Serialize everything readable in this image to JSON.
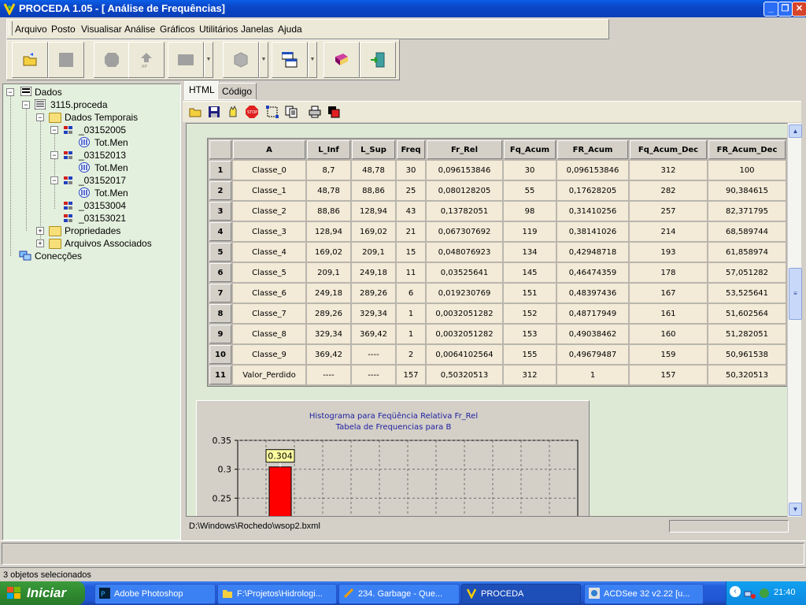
{
  "window": {
    "title": "PROCEDA 1.05 - [ Análise de Frequências]",
    "controls": [
      "minimize",
      "restore",
      "close"
    ]
  },
  "menu": [
    "Arquivo",
    "Posto",
    "Visualisar",
    "Análise",
    "Gráficos",
    "Utilitários",
    "Janelas",
    "Ajuda"
  ],
  "toolbar": {
    "icons": [
      "open-folder-icon",
      "stop-square-icon",
      "polygon-icon",
      "upload-area-icon",
      "rectangle-icon",
      "cube-icon",
      "windows-cascade-icon",
      "help-book-icon",
      "exit-door-icon"
    ]
  },
  "tree": {
    "root": "Dados",
    "file": "3115.proceda",
    "temporal": "Dados Temporais",
    "stations": [
      {
        "name": "_03152005",
        "child": "Tot.Men"
      },
      {
        "name": "_03152013",
        "child": "Tot.Men"
      },
      {
        "name": "_03152017",
        "child": "Tot.Men"
      },
      {
        "name": "_03153004",
        "child": ""
      },
      {
        "name": "_03153021",
        "child": ""
      }
    ],
    "props": "Propriedades",
    "assoc": "Arquivos Associados",
    "connections": "Conecções"
  },
  "tabs": [
    "HTML",
    "Código"
  ],
  "html_toolbar_icons": [
    "open-icon",
    "save-icon",
    "hand-icon",
    "stop-icon",
    "select-icon",
    "copy-icon",
    "print-icon",
    "color-icon"
  ],
  "table": {
    "headers": [
      "A",
      "L_Inf",
      "L_Sup",
      "Freq",
      "Fr_Rel",
      "Fq_Acum",
      "FR_Acum",
      "Fq_Acum_Dec",
      "FR_Acum_Dec"
    ],
    "rows": [
      [
        "1",
        "Classe_0",
        "8,7",
        "48,78",
        "30",
        "0,096153846",
        "30",
        "0,096153846",
        "312",
        "100"
      ],
      [
        "2",
        "Classe_1",
        "48,78",
        "88,86",
        "25",
        "0,080128205",
        "55",
        "0,17628205",
        "282",
        "90,384615"
      ],
      [
        "3",
        "Classe_2",
        "88,86",
        "128,94",
        "43",
        "0,13782051",
        "98",
        "0,31410256",
        "257",
        "82,371795"
      ],
      [
        "4",
        "Classe_3",
        "128,94",
        "169,02",
        "21",
        "0,067307692",
        "119",
        "0,38141026",
        "214",
        "68,589744"
      ],
      [
        "5",
        "Classe_4",
        "169,02",
        "209,1",
        "15",
        "0,048076923",
        "134",
        "0,42948718",
        "193",
        "61,858974"
      ],
      [
        "6",
        "Classe_5",
        "209,1",
        "249,18",
        "11",
        "0,03525641",
        "145",
        "0,46474359",
        "178",
        "57,051282"
      ],
      [
        "7",
        "Classe_6",
        "249,18",
        "289,26",
        "6",
        "0,019230769",
        "151",
        "0,48397436",
        "167",
        "53,525641"
      ],
      [
        "8",
        "Classe_7",
        "289,26",
        "329,34",
        "1",
        "0,0032051282",
        "152",
        "0,48717949",
        "161",
        "51,602564"
      ],
      [
        "9",
        "Classe_8",
        "329,34",
        "369,42",
        "1",
        "0,0032051282",
        "153",
        "0,49038462",
        "160",
        "51,282051"
      ],
      [
        "10",
        "Classe_9",
        "369,42",
        "----",
        "2",
        "0,0064102564",
        "155",
        "0,49679487",
        "159",
        "50,961538"
      ],
      [
        "11",
        "Valor_Perdido",
        "----",
        "----",
        "157",
        "0,50320513",
        "312",
        "1",
        "157",
        "50,320513"
      ]
    ]
  },
  "chart_data": {
    "type": "bar",
    "title": "Histograma para Feqüência Relativa Fr_Rel",
    "subtitle": "Tabela de Frequencias para B",
    "yticks": [
      "0.35",
      "0.3",
      "0.25"
    ],
    "ylim": [
      0.2,
      0.35
    ],
    "values": [
      0.304
    ],
    "tooltip": "0.304",
    "grid": true,
    "bar_color": "#ff0000"
  },
  "file_path": "D:\\Windows\\Rochedo\\wsop2.bxml",
  "status": "3 objetos selecionados",
  "taskbar": {
    "start": "Iniciar",
    "items": [
      "Adobe Photoshop",
      "F:\\Projetos\\Hidrologi...",
      "234. Garbage - Que...",
      "PROCEDA",
      "ACDSee 32 v2.22 [u..."
    ],
    "clock": "21:40"
  }
}
